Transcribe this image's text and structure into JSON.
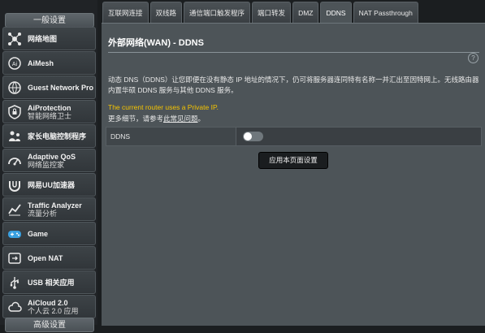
{
  "sidebar": {
    "general_header": "一般设置",
    "advanced_header": "高级设置",
    "items": [
      {
        "label": "网络地图",
        "sub": "",
        "icon": "network-map-icon"
      },
      {
        "label": "AiMesh",
        "sub": "",
        "icon": "aimesh-icon"
      },
      {
        "label": "Guest Network Pro",
        "sub": "",
        "icon": "guest-network-icon"
      },
      {
        "label": "AiProtection",
        "sub": "智能网络卫士",
        "icon": "shield-icon"
      },
      {
        "label": "家长电脑控制程序",
        "sub": "",
        "icon": "parental-control-icon"
      },
      {
        "label": "Adaptive QoS",
        "sub": "网络监控家",
        "icon": "qos-icon"
      },
      {
        "label": "网易UU加速器",
        "sub": "",
        "icon": "uu-accelerator-icon"
      },
      {
        "label": "Traffic Analyzer",
        "sub": "流量分析",
        "icon": "traffic-analyzer-icon"
      },
      {
        "label": "Game",
        "sub": "",
        "icon": "gamepad-icon"
      },
      {
        "label": "Open NAT",
        "sub": "",
        "icon": "open-nat-icon"
      },
      {
        "label": "USB 相关应用",
        "sub": "",
        "icon": "usb-icon"
      },
      {
        "label": "AiCloud 2.0",
        "sub": "个人云 2.0 应用",
        "icon": "cloud-icon"
      }
    ]
  },
  "tabs": [
    "互联网连接",
    "双线路",
    "通信端口触发程序",
    "端口转发",
    "DMZ",
    "DDNS",
    "NAT Passthrough"
  ],
  "panel": {
    "title": "外部网络(WAN) - DDNS",
    "help": "?",
    "description": "动态 DNS（DDNS）让您即便在没有静态 IP 地址的情况下，仍可将服务器连同特有名称一并汇出至因特网上。无线路由器内置华硕 DDNS 服务与其他 DDNS 服务。",
    "warning": "The current router uses a Private IP.",
    "faq_prefix": "更多细节，请参考",
    "faq_link": "此常见问题",
    "faq_suffix": "。",
    "ddns_label": "DDNS",
    "ddns_enabled": false,
    "apply_button": "应用本页面设置"
  },
  "colors": {
    "warning": "#f5c400",
    "panel_bg": "#4d5458",
    "sidebar_bg": "#202326"
  }
}
